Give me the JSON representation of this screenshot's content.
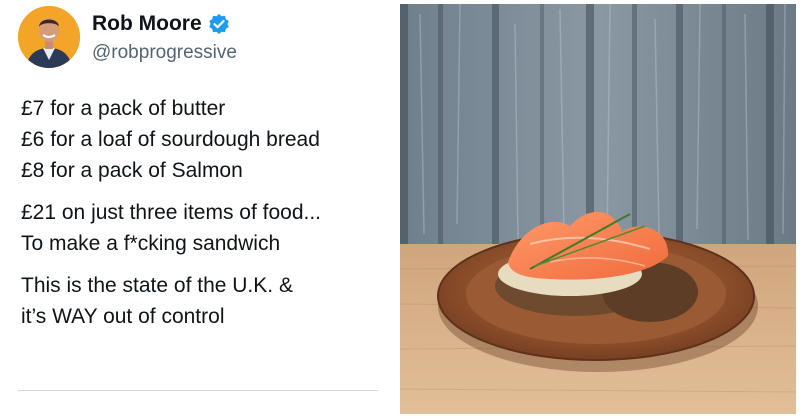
{
  "tweet": {
    "author": {
      "display_name": "Rob Moore",
      "handle": "@robprogressive",
      "verified": true,
      "avatar_icon": "profile-photo",
      "verified_icon": "verified-badge-icon"
    },
    "paragraphs": [
      {
        "lines": [
          "£7 for a pack of butter",
          "£6 for a loaf of sourdough bread",
          "£8 for a pack of Salmon"
        ]
      },
      {
        "lines": [
          "£21 on just three items of food...",
          "To make a f*cking sandwich"
        ]
      },
      {
        "lines": [
          "This is the state of the U.K. &",
          "it’s WAY out of control"
        ]
      }
    ]
  },
  "media": {
    "icon": "photo-smoked-salmon-open-sandwich-on-plate"
  },
  "colors": {
    "avatar_bg": "#f3a52a",
    "verified_blue": "#1d9bf0",
    "text": "#0f1419",
    "muted": "#536471"
  }
}
